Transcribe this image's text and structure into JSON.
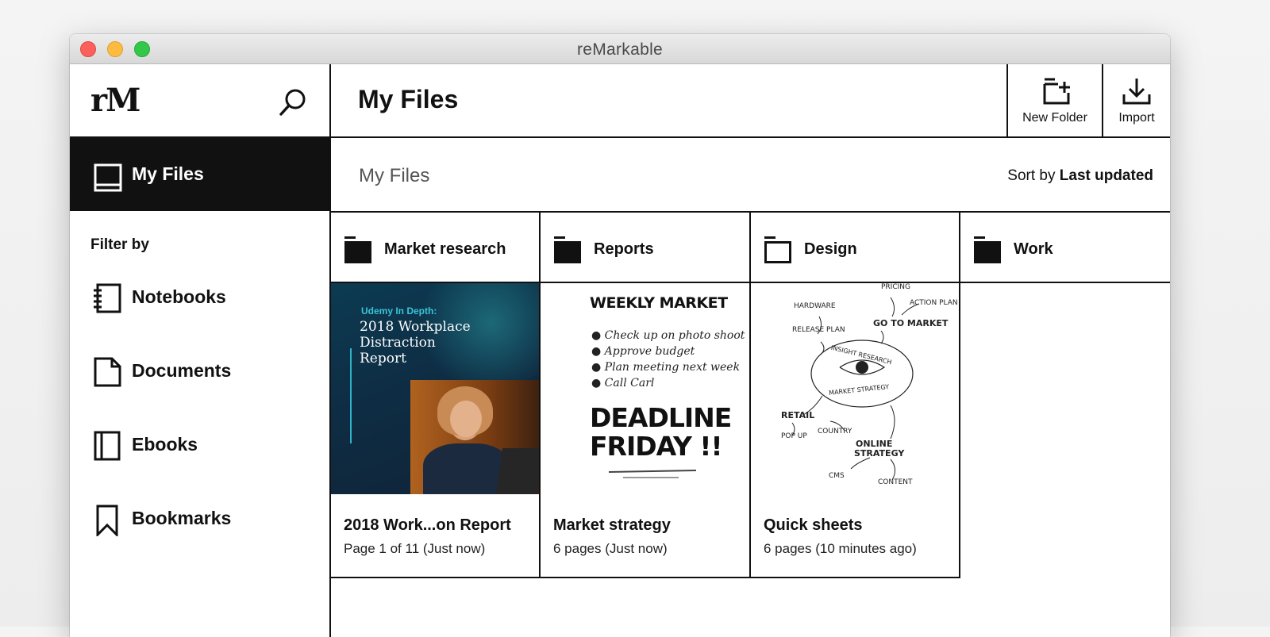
{
  "window": {
    "title": "reMarkable"
  },
  "sidebar": {
    "logo": "rM",
    "active": {
      "label": "My Files",
      "icon": "tablet-icon"
    },
    "filter_label": "Filter by",
    "filters": [
      {
        "label": "Notebooks",
        "icon": "notebook-icon"
      },
      {
        "label": "Documents",
        "icon": "document-icon"
      },
      {
        "label": "Ebooks",
        "icon": "ebook-icon"
      },
      {
        "label": "Bookmarks",
        "icon": "bookmark-icon"
      }
    ]
  },
  "header": {
    "title": "My Files",
    "new_folder": "New Folder",
    "import": "Import"
  },
  "breadcrumb": "My Files",
  "sort": {
    "prefix": "Sort by",
    "value": "Last updated"
  },
  "folders": [
    {
      "name": "Market research",
      "filled": true
    },
    {
      "name": "Reports",
      "filled": true
    },
    {
      "name": "Design",
      "filled": false
    },
    {
      "name": "Work",
      "filled": true
    }
  ],
  "files": [
    {
      "title": "2018 Work...on Report",
      "meta": "Page 1 of 11 (Just now)",
      "cover": {
        "kicker": "Udemy In Depth:",
        "line1": "2018 Workplace",
        "line2": "Distraction",
        "line3": "Report"
      }
    },
    {
      "title": "Market strategy",
      "meta": "6 pages (Just now)",
      "notes": {
        "heading": "WEEKLY MARKET",
        "items": [
          "Check up on photo shoot",
          "Approve budget",
          "Plan meeting next week",
          "Call Carl"
        ],
        "big1": "DEADLINE",
        "big2": "FRIDAY !!"
      }
    },
    {
      "title": "Quick sheets",
      "meta": "6 pages (10 minutes ago)",
      "mindmap": [
        "PRICING",
        "HARDWARE",
        "ACTION PLAN",
        "GO TO MARKET",
        "RELEASE PLAN",
        "INSIGHT RESEARCH",
        "MARKET STRATEGY",
        "RETAIL",
        "POP UP",
        "COUNTRY",
        "ONLINE",
        "STRATEGY",
        "CMS",
        "CONTENT"
      ]
    }
  ]
}
